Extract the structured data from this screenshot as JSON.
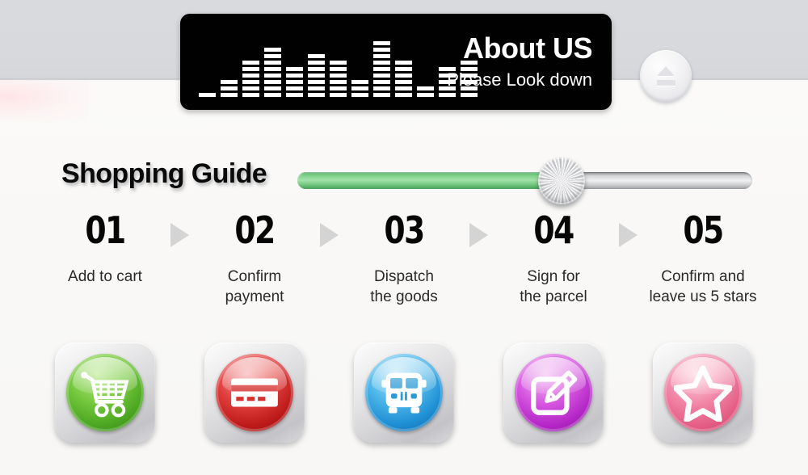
{
  "header": {
    "title": "About US",
    "subtitle": "Please Look down",
    "equalizer": {
      "name": "audio-equalizer-graphic",
      "bar_segment_counts": [
        1,
        3,
        6,
        8,
        5,
        7,
        6,
        3,
        9,
        6,
        2,
        5,
        6
      ]
    },
    "eject_button_label": "eject"
  },
  "guide": {
    "title": "Shopping Guide",
    "progress": {
      "percent": 58,
      "fill_color": "#7fd089",
      "track_color": "#d3d5d7"
    }
  },
  "steps": [
    {
      "number": "01",
      "label": "Add to cart",
      "icon": "shopping-cart-icon",
      "color": "#77c93f",
      "disc_class": "disc-green"
    },
    {
      "number": "02",
      "label": "Confirm\npayment",
      "icon": "credit-card-icon",
      "color": "#e2403f",
      "disc_class": "disc-red"
    },
    {
      "number": "03",
      "label": "Dispatch\nthe goods",
      "icon": "delivery-bus-icon",
      "color": "#4fb8ea",
      "disc_class": "disc-blue"
    },
    {
      "number": "04",
      "label": "Sign for\nthe parcel",
      "icon": "sign-pencil-icon",
      "color": "#d657e0",
      "disc_class": "disc-purple"
    },
    {
      "number": "05",
      "label": "Confirm and\nleave us 5 stars",
      "icon": "star-icon",
      "color": "#f287a8",
      "disc_class": "disc-pink"
    }
  ],
  "separator_icon": "triangle-right-icon",
  "colors": {
    "band_top": "#d8dade",
    "band_bottom": "#faf9f7",
    "plaque": "#010101",
    "text_dark": "#060606"
  }
}
